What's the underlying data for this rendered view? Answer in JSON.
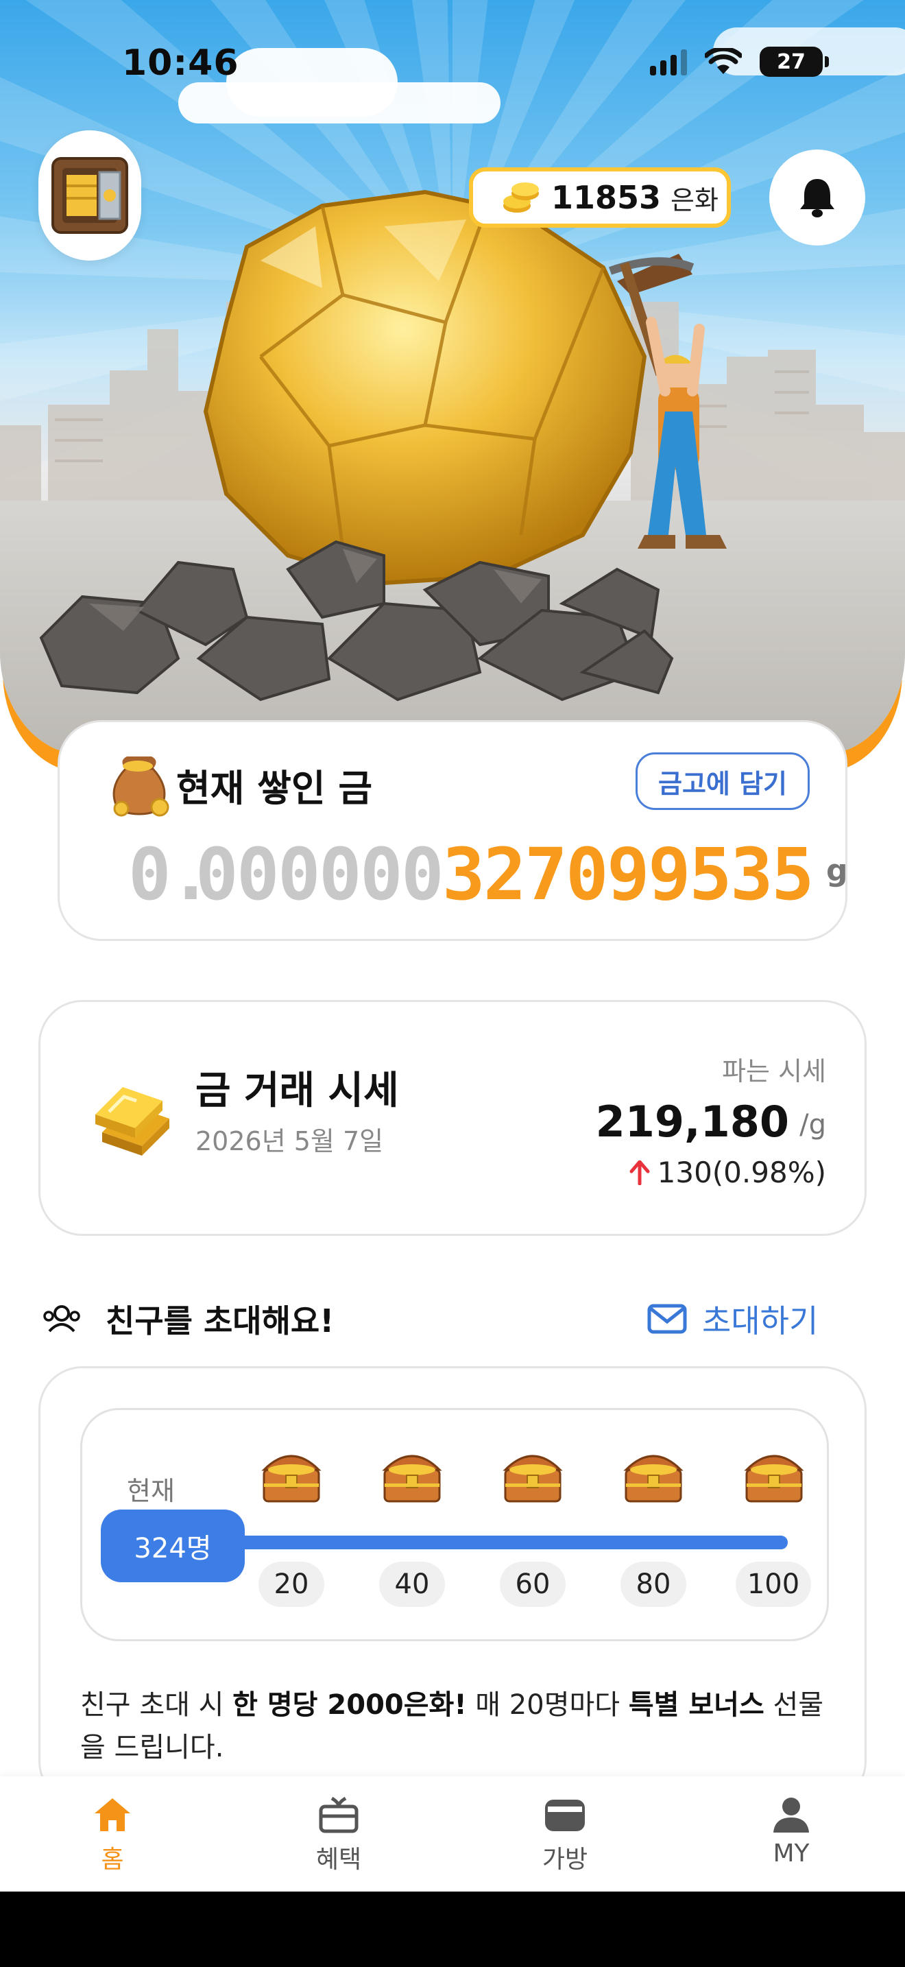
{
  "status_bar": {
    "time": "10:46",
    "battery": "27"
  },
  "header": {
    "coin_count": "11853",
    "coin_unit": "은화"
  },
  "gold_card": {
    "title": "현재 쌓인 금",
    "store_button": "금고에 담기",
    "digits_gray": [
      "0",
      ".",
      "0",
      "0",
      "0",
      "0",
      "0",
      "0"
    ],
    "digits_orange": [
      "3",
      "2",
      "7",
      "0",
      "9",
      "9",
      "5",
      "3",
      "5"
    ],
    "unit": "g"
  },
  "price_card": {
    "title": "금 거래 시세",
    "date": "2026년 5월 7일",
    "label": "파는 시세",
    "value": "219,180",
    "unit": "/g",
    "change": "130(0.98%)"
  },
  "invite": {
    "title": "친구를 초대해요!",
    "button": "초대하기",
    "current_label": "현재",
    "current_count": "324명",
    "milestones": [
      "20",
      "40",
      "60",
      "80",
      "100"
    ],
    "desc_1": "친구 초대 시 ",
    "desc_bold_1": "한 명당 2000은화!",
    "desc_2": " 매 20명마다 ",
    "desc_bold_2": "특별 보너스",
    "desc_3": " 선물을 드립니다."
  },
  "tabs": [
    {
      "label": "홈",
      "icon": "home-icon",
      "active": true
    },
    {
      "label": "혜택",
      "icon": "gift-icon",
      "active": false
    },
    {
      "label": "가방",
      "icon": "wallet-icon",
      "active": false
    },
    {
      "label": "MY",
      "icon": "person-icon",
      "active": false
    }
  ],
  "colors": {
    "accent_orange": "#f59218",
    "accent_blue": "#3d7ee6",
    "gold_yellow": "#fcc533",
    "up_red": "#e8333c"
  }
}
